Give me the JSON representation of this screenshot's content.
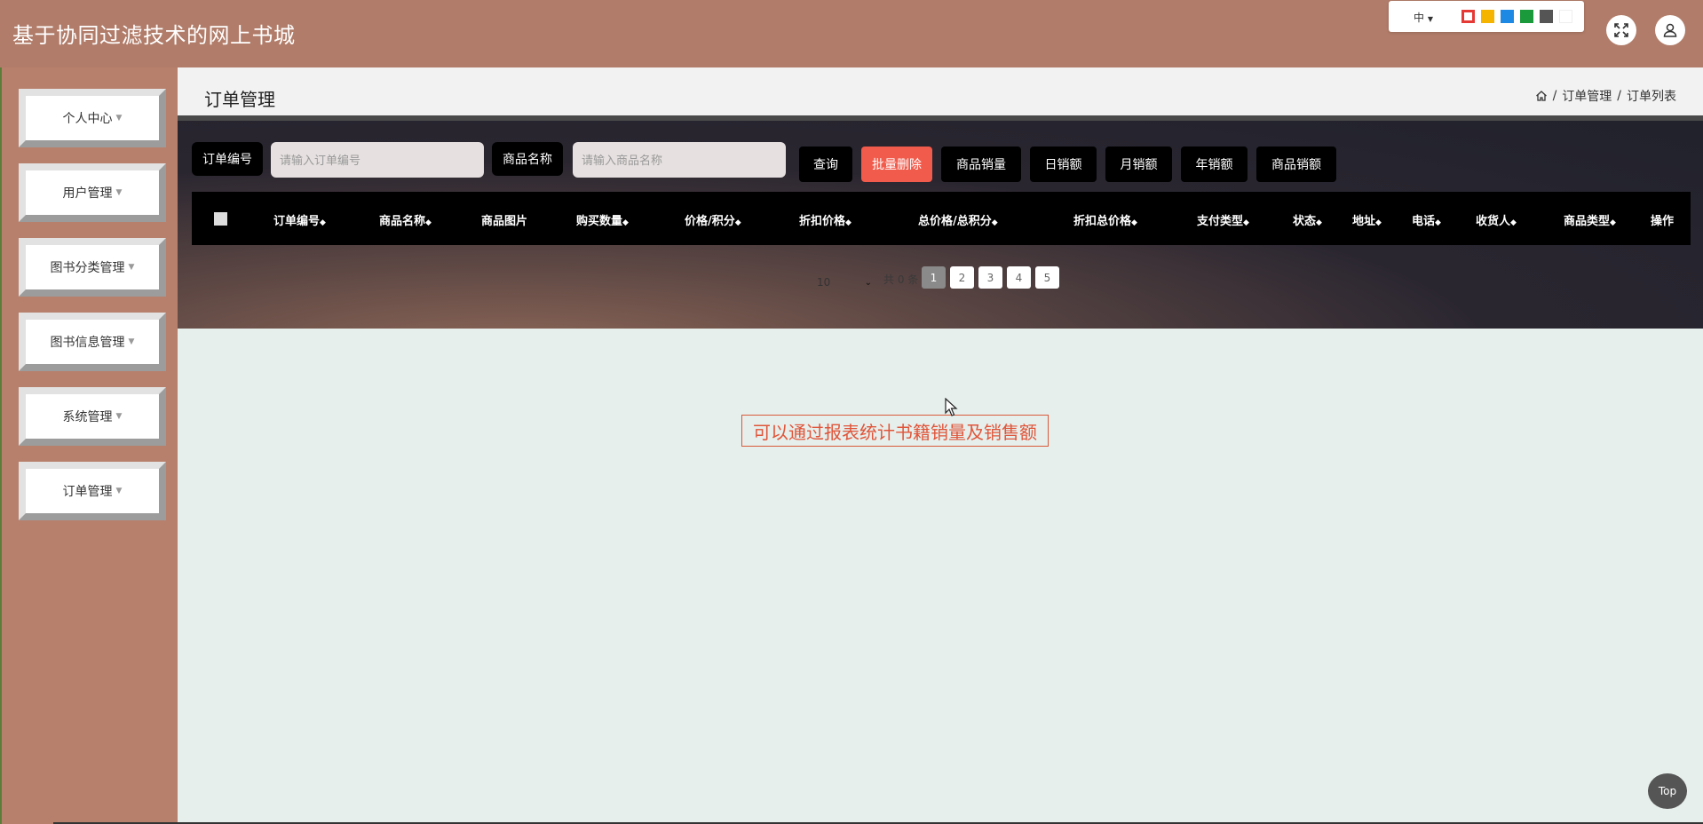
{
  "header": {
    "title": "基于协同过滤技术的网上书城",
    "lang_label": "中",
    "theme_colors": [
      "#e53935",
      "#f4b400",
      "#1e88e5",
      "#1a9a3a",
      "#555555",
      "#ffffff"
    ]
  },
  "sidebar": {
    "items": [
      {
        "label": "个人中心"
      },
      {
        "label": "用户管理"
      },
      {
        "label": "图书分类管理"
      },
      {
        "label": "图书信息管理"
      },
      {
        "label": "系统管理"
      },
      {
        "label": "订单管理"
      }
    ]
  },
  "page": {
    "title": "订单管理",
    "breadcrumb": [
      "订单管理",
      "订单列表"
    ]
  },
  "search": {
    "order_no_label": "订单编号",
    "order_no_placeholder": "请输入订单编号",
    "product_name_label": "商品名称",
    "product_name_placeholder": "请输入商品名称"
  },
  "actions": {
    "query": "查询",
    "batch_delete": "批量删除",
    "product_sales_qty": "商品销量",
    "daily_sales": "日销额",
    "monthly_sales": "月销额",
    "yearly_sales": "年销额",
    "product_sales_amount": "商品销额"
  },
  "table": {
    "columns": [
      "订单编号",
      "商品名称",
      "商品图片",
      "购买数量",
      "价格/积分",
      "折扣价格",
      "总价格/总积分",
      "折扣总价格",
      "支付类型",
      "状态",
      "地址",
      "电话",
      "收货人",
      "商品类型",
      "操作"
    ]
  },
  "pagination": {
    "page_size": "10",
    "total_label": "共 0 条",
    "pages": [
      "1",
      "2",
      "3",
      "4",
      "5"
    ],
    "current": "1"
  },
  "annotation": "可以通过报表统计书籍销量及销售额",
  "top_button": "Top"
}
